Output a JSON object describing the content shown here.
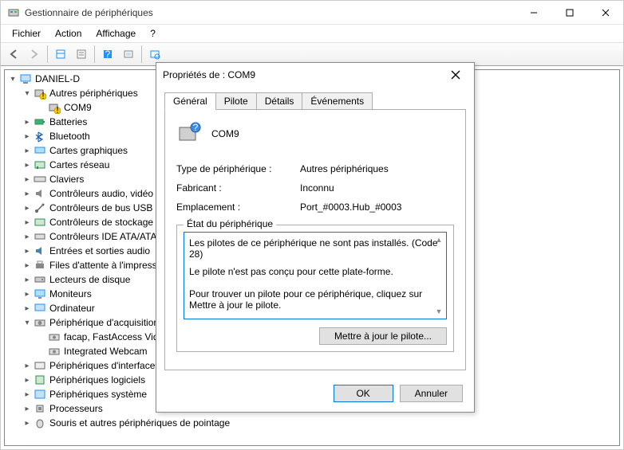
{
  "window": {
    "title": "Gestionnaire de périphériques",
    "menus": {
      "file": "Fichier",
      "action": "Action",
      "view": "Affichage",
      "help": "?"
    }
  },
  "tree": {
    "root": "DANIEL-D",
    "other_devices": "Autres périphériques",
    "com9": "COM9",
    "batteries": "Batteries",
    "bluetooth": "Bluetooth",
    "graphics": "Cartes graphiques",
    "net_cards": "Cartes réseau",
    "keyboards": "Claviers",
    "audio_ctrl": "Contrôleurs audio, vidéo et jeu",
    "usb_ctrl": "Contrôleurs de bus USB",
    "storage_ctrl": "Contrôleurs de stockage",
    "ide_ctrl": "Contrôleurs IDE ATA/ATAPI",
    "audio_io": "Entrées et sorties audio",
    "print_queue": "Files d'attente à l'impression",
    "disk_drives": "Lecteurs de disque",
    "monitors": "Moniteurs",
    "computer": "Ordinateur",
    "imaging": "Périphérique d'acquisition d'images",
    "imaging_a": "facap, FastAccess Video Capture",
    "imaging_b": "Integrated Webcam",
    "hid": "Périphériques d'interface utilisateur",
    "software_dev": "Périphériques logiciels",
    "system_dev": "Périphériques système",
    "processors": "Processeurs",
    "mice": "Souris et autres périphériques de pointage"
  },
  "dialog": {
    "title": "Propriétés de : COM9",
    "tabs": {
      "general": "Général",
      "driver": "Pilote",
      "details": "Détails",
      "events": "Événements"
    },
    "dev_name": "COM9",
    "type_label": "Type de périphérique :",
    "type_value": "Autres périphériques",
    "mfr_label": "Fabricant :",
    "mfr_value": "Inconnu",
    "loc_label": "Emplacement :",
    "loc_value": "Port_#0003.Hub_#0003",
    "state_legend": "État du périphérique",
    "state_text1": "Les pilotes de ce périphérique ne sont pas installés. (Code 28)",
    "state_text2": "Le pilote n'est pas conçu pour cette plate-forme.",
    "state_text3": "Pour trouver un pilote pour ce périphérique, cliquez sur Mettre à jour le pilote.",
    "update_btn": "Mettre à jour le pilote...",
    "ok": "OK",
    "cancel": "Annuler"
  }
}
